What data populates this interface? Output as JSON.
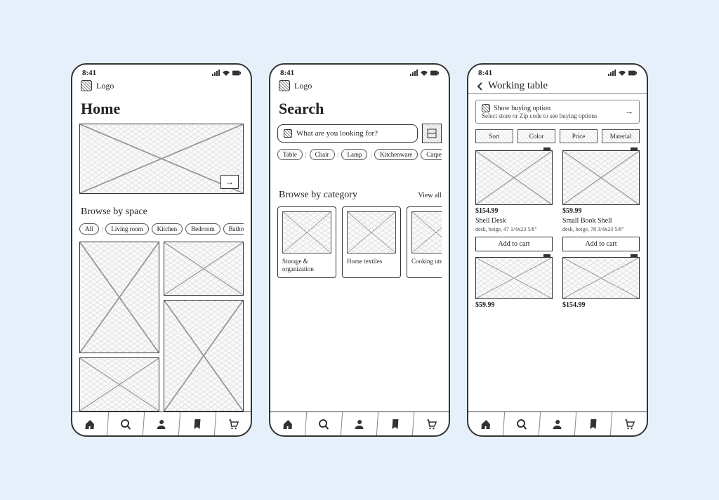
{
  "status": {
    "time": "8:41"
  },
  "brand": {
    "logo_label": "Logo"
  },
  "home": {
    "title": "Home",
    "browse_label": "Browse by space",
    "spaces": [
      "All",
      "Living room",
      "Kitchen",
      "Bedroom",
      "Bathroom"
    ]
  },
  "search": {
    "title": "Search",
    "placeholder": "What are you looking for?",
    "tags": [
      "Table",
      "Chair",
      "Lamp",
      "Kitchenware",
      "Carpet"
    ],
    "browse_label": "Browse by category",
    "view_all": "View all",
    "categories": [
      {
        "label": "Storage & organization"
      },
      {
        "label": "Home textiles"
      },
      {
        "label": "Cooking utensil"
      }
    ]
  },
  "results": {
    "title": "Working table",
    "buying_option": {
      "heading": "Show buying option",
      "sub": "Select store or Zip code to see buying options"
    },
    "filters": [
      "Sort",
      "Color",
      "Price",
      "Material"
    ],
    "products": [
      {
        "price": "$154.99",
        "name": "Shell Desk",
        "desc": "desk, beige, 47 1/4x23 5/8\"",
        "cta": "Add to cart"
      },
      {
        "price": "$59.99",
        "name": "Small Book Shell",
        "desc": "desk, beige, 78 3/4x23 5/8\"",
        "cta": "Add to cart"
      },
      {
        "price": "$59.99"
      },
      {
        "price": "$154.99"
      }
    ]
  },
  "nav_icons": [
    "home",
    "search",
    "profile",
    "bookmark",
    "cart"
  ]
}
